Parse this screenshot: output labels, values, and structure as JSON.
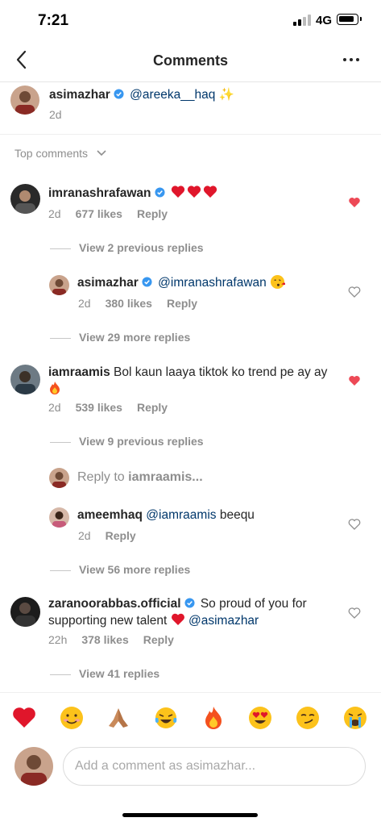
{
  "status_bar": {
    "time": "7:21",
    "network": "4G"
  },
  "header": {
    "title": "Comments"
  },
  "caption": {
    "username": "asimazhar",
    "mention": "@areeka__haq",
    "emoji": "✨",
    "time": "2d"
  },
  "sort": {
    "label": "Top comments"
  },
  "comments": [
    {
      "username": "imranashrafawan",
      "text": "",
      "time": "2d",
      "likes": "677 likes",
      "reply": "Reply",
      "liked": true
    },
    {
      "username": "asimazhar",
      "mention": "@imranashrafawan",
      "time": "2d",
      "likes": "380 likes",
      "reply": "Reply",
      "liked": false
    },
    {
      "username": "iamraamis",
      "text": "Bol kaun laaya tiktok ko trend pe ay ay",
      "time": "2d",
      "likes": "539 likes",
      "reply": "Reply",
      "liked": true
    },
    {
      "username": "ameemhaq",
      "mention": "@iamraamis",
      "text": "beequ",
      "time": "2d",
      "reply": "Reply",
      "liked": false
    },
    {
      "username": "zaranoorabbas.official",
      "text1": "So proud of you for",
      "text2": "supporting new talent",
      "mention": "@asimazhar",
      "time": "22h",
      "likes": "378 likes",
      "reply": "Reply",
      "liked": false
    }
  ],
  "view_links": {
    "prev_replies_1": "View 2 previous replies",
    "more_replies_1": "View 29 more replies",
    "prev_replies_2": "View 9 previous replies",
    "more_replies_2": "View 56 more replies",
    "replies_3": "View 41 replies"
  },
  "inline_reply": {
    "prefix": "Reply to ",
    "user": "iamraamis..."
  },
  "emoji_bar": [
    "heart",
    "smiling-face",
    "folded-hands",
    "tears-of-joy",
    "fire",
    "heart-eyes",
    "smirk",
    "crying-face"
  ],
  "comment_input": {
    "placeholder": "Add a comment as asimazhar..."
  },
  "colors": {
    "like_red": "#ed4956",
    "verified_blue": "#3897f0",
    "mention_blue": "#00376b",
    "meta_gray": "#8e8e8e"
  }
}
